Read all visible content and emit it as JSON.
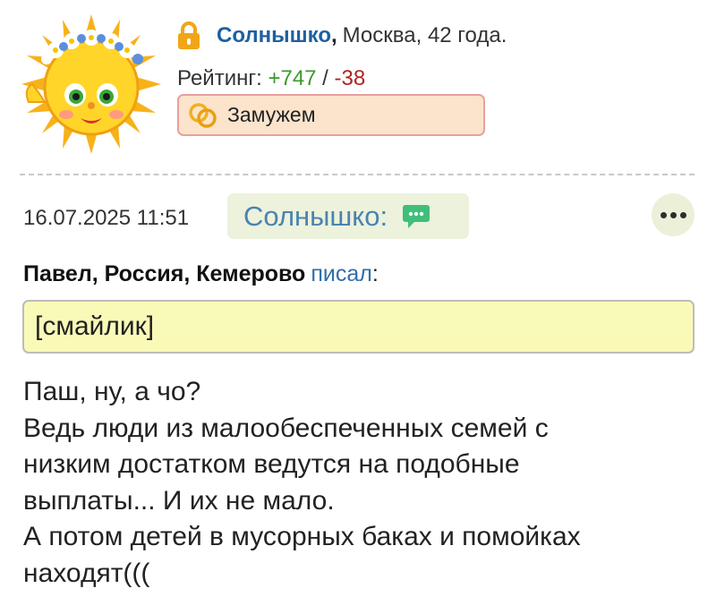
{
  "profile": {
    "name": "Солнышко",
    "comma": ",",
    "meta": "Москва, 42 года.",
    "rating_label": "Рейтинг: ",
    "rating_plus": "+747",
    "rating_sep": " / ",
    "rating_minus": "-38",
    "status": "Замужем",
    "avatar_icon": "sun-avatar-icon",
    "lock_icon": "lock-icon",
    "status_icon": "wedding-rings-icon"
  },
  "post": {
    "date": "16.07.2025 11:51",
    "author": "Солнышко:",
    "author_icon": "chat-bubble-icon",
    "more_icon": "more-dots-icon"
  },
  "quote": {
    "author": "Павел, Россия, Кемерово",
    "wrote": "писал",
    "colon": ":",
    "text": "[смайлик]"
  },
  "message": {
    "lines": [
      "Паш, ну, а чо?",
      "Ведь люди из малообеспеченных семей с",
      "низким достатком ведутся на подобные",
      "выплаты... И их не мало.",
      "А потом детей в мусорных баках и помойках",
      "находят((("
    ]
  },
  "colors": {
    "link_blue": "#1e5fa0",
    "rating_plus": "#3a9a2a",
    "rating_minus": "#b22222",
    "status_bg": "#fce4cc",
    "quote_bg": "#fafab8",
    "chip_bg": "#ecf2dc"
  }
}
